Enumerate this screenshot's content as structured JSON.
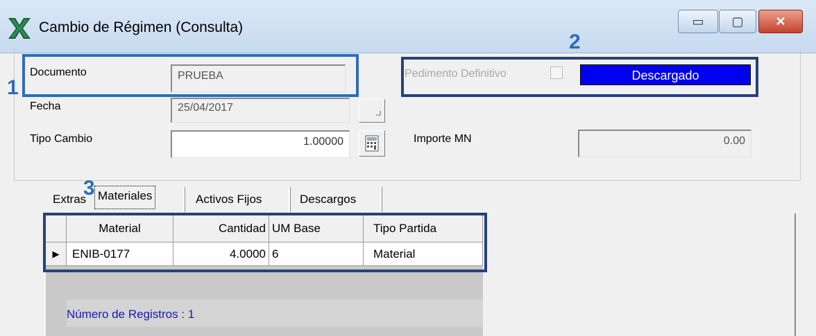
{
  "window": {
    "title": "Cambio de Régimen (Consulta)",
    "minimize_glyph": "▭",
    "maximize_glyph": "▢",
    "close_glyph": "✕"
  },
  "form": {
    "documento_label": "Documento",
    "documento_value": "PRUEBA",
    "fecha_label": "Fecha",
    "fecha_value": "25/04/2017",
    "tipo_cambio_label": "Tipo Cambio",
    "tipo_cambio_value": "1.00000",
    "pedimento_label": "Pedimento Definitivo",
    "status": "Descargado",
    "importe_label": "Importe MN",
    "importe_value": "0.00"
  },
  "annotations": [
    "1",
    "2",
    "3"
  ],
  "tabs": [
    {
      "label": "Extras"
    },
    {
      "label": "Materiales"
    },
    {
      "label": "Activos Fijos"
    },
    {
      "label": "Descargos"
    }
  ],
  "grid": {
    "columns": [
      "Material",
      "Cantidad",
      "UM Base",
      "Tipo Partida"
    ],
    "rows": [
      {
        "material": "ENIB-0177",
        "cantidad": "4.0000",
        "um_base": "6",
        "tipo_partida": "Material"
      }
    ],
    "row_indicator": "▶",
    "record_count_label": "Número de Registros : 1"
  },
  "colors": {
    "status_bg": "#0000f0",
    "annotation_blue": "#2f6db7",
    "annotation_dark": "#26427a"
  },
  "icons": [
    "app-x-logo-icon",
    "calendar-icon",
    "calculator-icon"
  ]
}
